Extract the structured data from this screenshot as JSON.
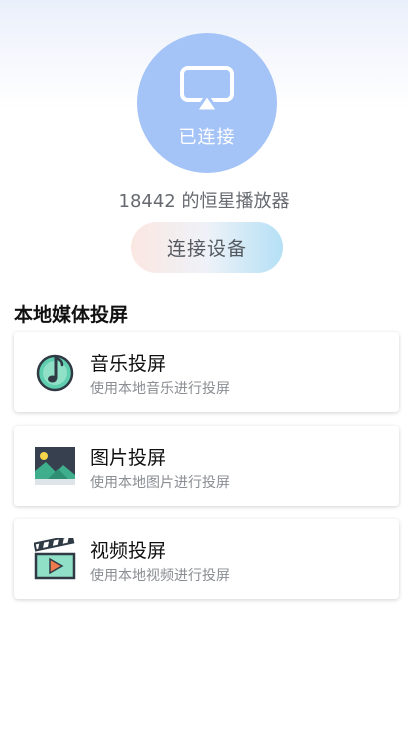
{
  "cast": {
    "icon": "screen-cast-icon",
    "status": "已连接"
  },
  "device": {
    "name": "18442 的恒星播放器"
  },
  "connect_button": {
    "label": "连接设备"
  },
  "local_section": {
    "title": "本地媒体投屏",
    "items": [
      {
        "icon": "music-note-icon",
        "title": "音乐投屏",
        "subtitle": "使用本地音乐进行投屏"
      },
      {
        "icon": "picture-icon",
        "title": "图片投屏",
        "subtitle": "使用本地图片进行投屏"
      },
      {
        "icon": "video-clapper-icon",
        "title": "视频投屏",
        "subtitle": "使用本地视频进行投屏"
      }
    ]
  },
  "colors": {
    "circle": "#a4c3f7",
    "music_icon": "#5fcfb0",
    "picture_icon_sky": "#37404f",
    "picture_icon_grass": "#3fae8c",
    "video_icon": "#35c39a",
    "video_play": "#ee7a4d"
  }
}
